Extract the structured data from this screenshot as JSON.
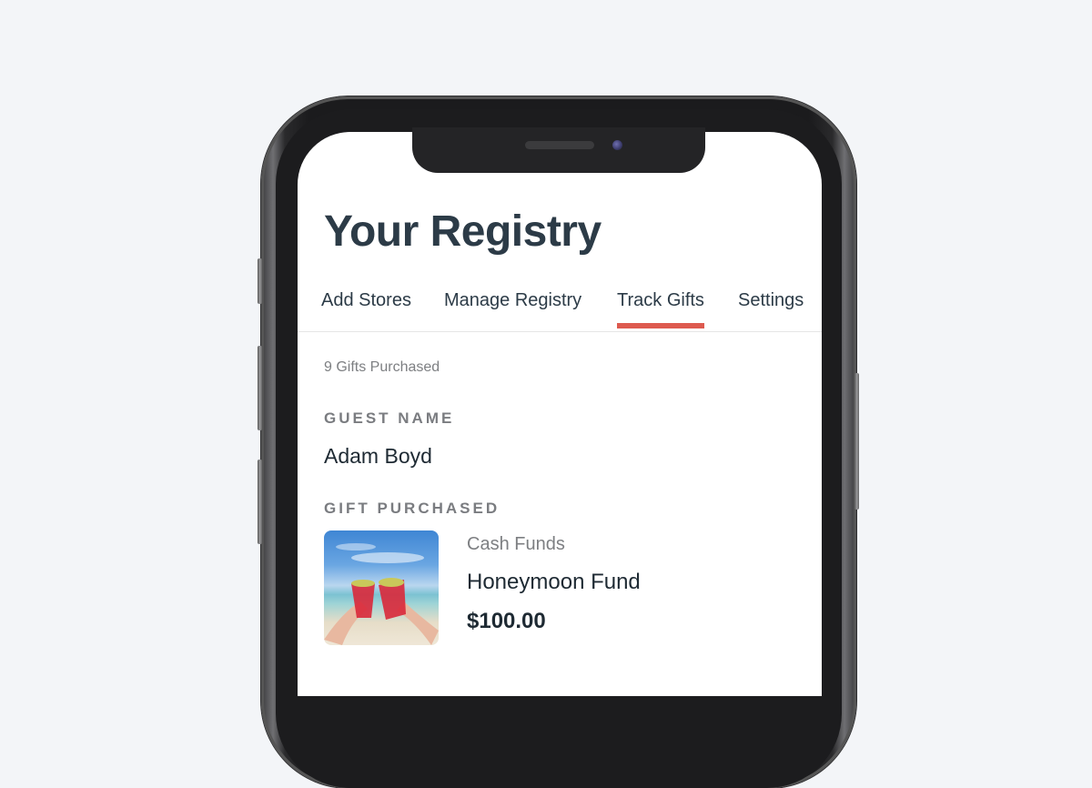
{
  "app": {
    "title": "Your Registry"
  },
  "tabs": [
    {
      "label": "Add Stores",
      "active": false
    },
    {
      "label": "Manage Registry",
      "active": false
    },
    {
      "label": "Track Gifts",
      "active": true
    },
    {
      "label": "Settings",
      "active": false
    }
  ],
  "summary": {
    "gifts_purchased": "9 Gifts Purchased"
  },
  "gift": {
    "guest_label": "GUEST NAME",
    "guest_name": "Adam Boyd",
    "gift_label": "GIFT PURCHASED",
    "image": "beach-cocktails-photo",
    "category": "Cash Funds",
    "name": "Honeymoon Fund",
    "price": "$100.00"
  },
  "colors": {
    "accent": "#dd5a4f",
    "title_text": "#2c3b47",
    "muted_text": "#7d7f82",
    "background": "#f3f5f8"
  }
}
